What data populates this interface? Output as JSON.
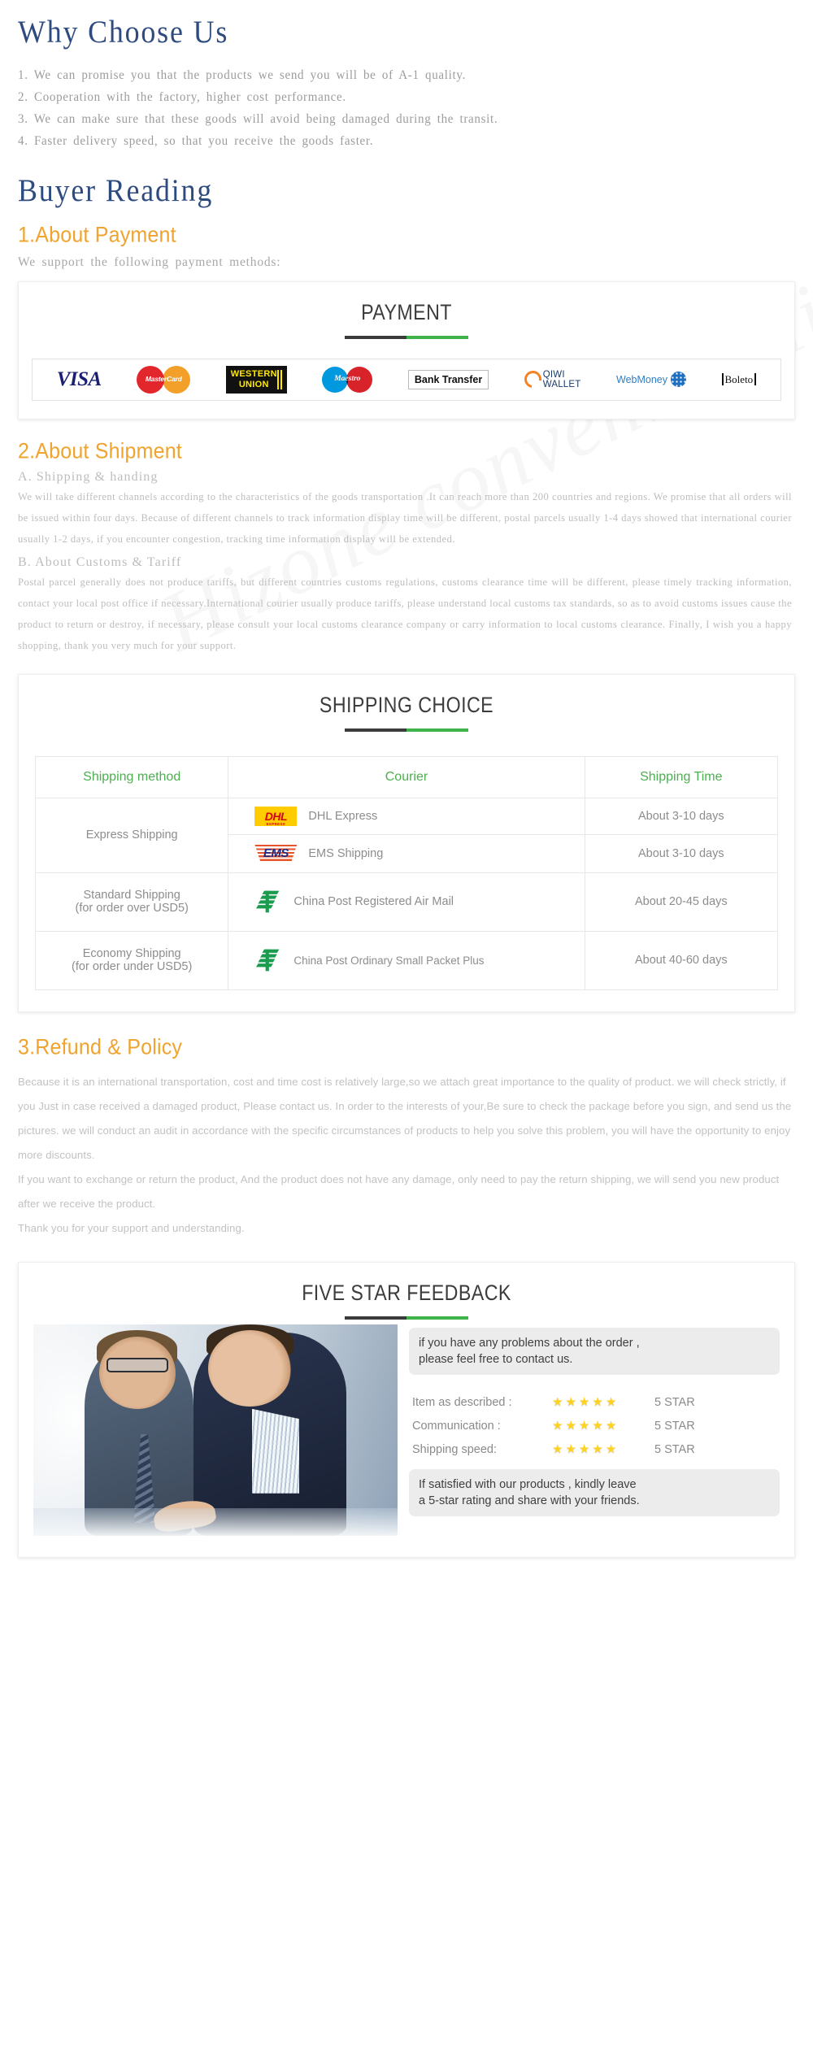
{
  "watermark": "Hizone convenient life store",
  "why_choose": {
    "heading": "Why Choose Us",
    "items": [
      "1. We can promise you that the products we send you will be of A-1 quality.",
      "2. Cooperation with the factory, higher cost performance.",
      "3. We can make sure that these goods will avoid being damaged during the transit.",
      "4. Faster delivery speed, so that you receive the goods faster."
    ]
  },
  "buyer_reading": {
    "heading": "Buyer  Reading"
  },
  "payment": {
    "section_heading": "1.About Payment",
    "lead": "We support the following payment methods:",
    "card_title": "PAYMENT",
    "methods": [
      {
        "name": "visa-logo",
        "label": "VISA"
      },
      {
        "name": "mastercard-logo",
        "label": "MasterCard"
      },
      {
        "name": "western-union-logo",
        "label_line1": "WESTERN",
        "label_line2": "UNION"
      },
      {
        "name": "maestro-logo",
        "label": "Maestro"
      },
      {
        "name": "bank-transfer-logo",
        "label": "Bank Transfer"
      },
      {
        "name": "qiwi-wallet-logo",
        "label_line1": "QIWI",
        "label_line2": "WALLET"
      },
      {
        "name": "webmoney-logo",
        "label": "WebMoney"
      },
      {
        "name": "boleto-logo",
        "label": "Boleto"
      }
    ]
  },
  "shipment": {
    "section_heading": "2.About Shipment",
    "sub_a": "A. Shipping & handing",
    "para_a": "We will take different channels according to the characteristics of the goods transportation .It can reach more than 200 countries and regions. We promise that all orders will be issued within four days. Because of different channels to track information display time will be different, postal parcels usually 1-4 days showed that international courier usually 1-2 days, if you encounter congestion, tracking time information display will be extended.",
    "sub_b": "B. About Customs & Tariff",
    "para_b": "Postal parcel generally does not produce tariffs, but different countries customs regulations, customs clearance time will be different, please timely tracking information, contact your local post office if necessary.International courier usually produce tariffs, please understand local customs tax standards, so as to avoid customs issues cause the product to return or destroy, if necessary, please consult your local customs clearance company or carry information to local customs clearance. Finally, I wish you a happy shopping, thank you very much for your support.",
    "card_title": "SHIPPING CHOICE",
    "table": {
      "headers": [
        "Shipping method",
        "Courier",
        "Shipping Time"
      ],
      "rows": [
        {
          "method": "Express Shipping",
          "method_sub": "",
          "rowspan": 2,
          "couriers": [
            {
              "logo": "dhl-logo",
              "logo_text": "DHL",
              "logo_sub": "EXPRESS",
              "name": "DHL Express",
              "time": "About 3-10 days"
            },
            {
              "logo": "ems-logo",
              "logo_text": "EMS",
              "logo_sub": "",
              "name": "EMS Shipping",
              "time": "About 3-10 days"
            }
          ]
        },
        {
          "method": "Standard Shipping",
          "method_sub": "(for order over USD5)",
          "rowspan": 1,
          "couriers": [
            {
              "logo": "china-post-logo",
              "logo_text": "",
              "logo_sub": "",
              "name": "China Post Registered Air Mail",
              "time": "About 20-45 days"
            }
          ]
        },
        {
          "method": "Economy Shipping",
          "method_sub": "(for order under USD5)",
          "rowspan": 1,
          "couriers": [
            {
              "logo": "china-post-logo",
              "logo_text": "",
              "logo_sub": "",
              "name": "China Post Ordinary Small Packet Plus",
              "time": "About 40-60 days"
            }
          ]
        }
      ]
    }
  },
  "refund": {
    "section_heading": "3.Refund & Policy",
    "paragraphs": [
      "Because it is an international transportation, cost and time cost is relatively large,so we attach great importance to the quality of product. we will check strictly, if you Just in case received a damaged product, Please contact us. In order to the interests of your,Be sure to check the package before you sign, and send us the pictures. we will conduct an audit in accordance with the specific circumstances of products to help you solve this problem, you will have the opportunity to enjoy more discounts.",
      "If you want to exchange or return the product, And the product does not have any damage, only need to pay the return shipping, we will send you new product after we receive the product.",
      "Thank you for your support and understanding."
    ]
  },
  "feedback": {
    "card_title": "FIVE STAR FEEDBACK",
    "photo_alt": "two-businessmen-reviewing-document",
    "bubble_top": "if you have any problems about the order ,\nplease feel free to contact us.",
    "ratings": [
      {
        "label": "Item as described :",
        "stars": 5,
        "value": "5 STAR"
      },
      {
        "label": "Communication :",
        "stars": 5,
        "value": "5 STAR"
      },
      {
        "label": "Shipping speed:",
        "stars": 5,
        "value": "5 STAR"
      }
    ],
    "bubble_bottom": "If satisfied with our products ,  kindly leave\na 5-star rating and share with your friends."
  },
  "colors": {
    "heading_blue": "#2e4b80",
    "heading_orange": "#f0a32e",
    "table_header_green": "#4caf50",
    "rule_green": "#3fb24a",
    "rule_dark": "#3b3b3b",
    "body_gray": "#bdbdbd",
    "star_yellow": "#ffd21e"
  }
}
